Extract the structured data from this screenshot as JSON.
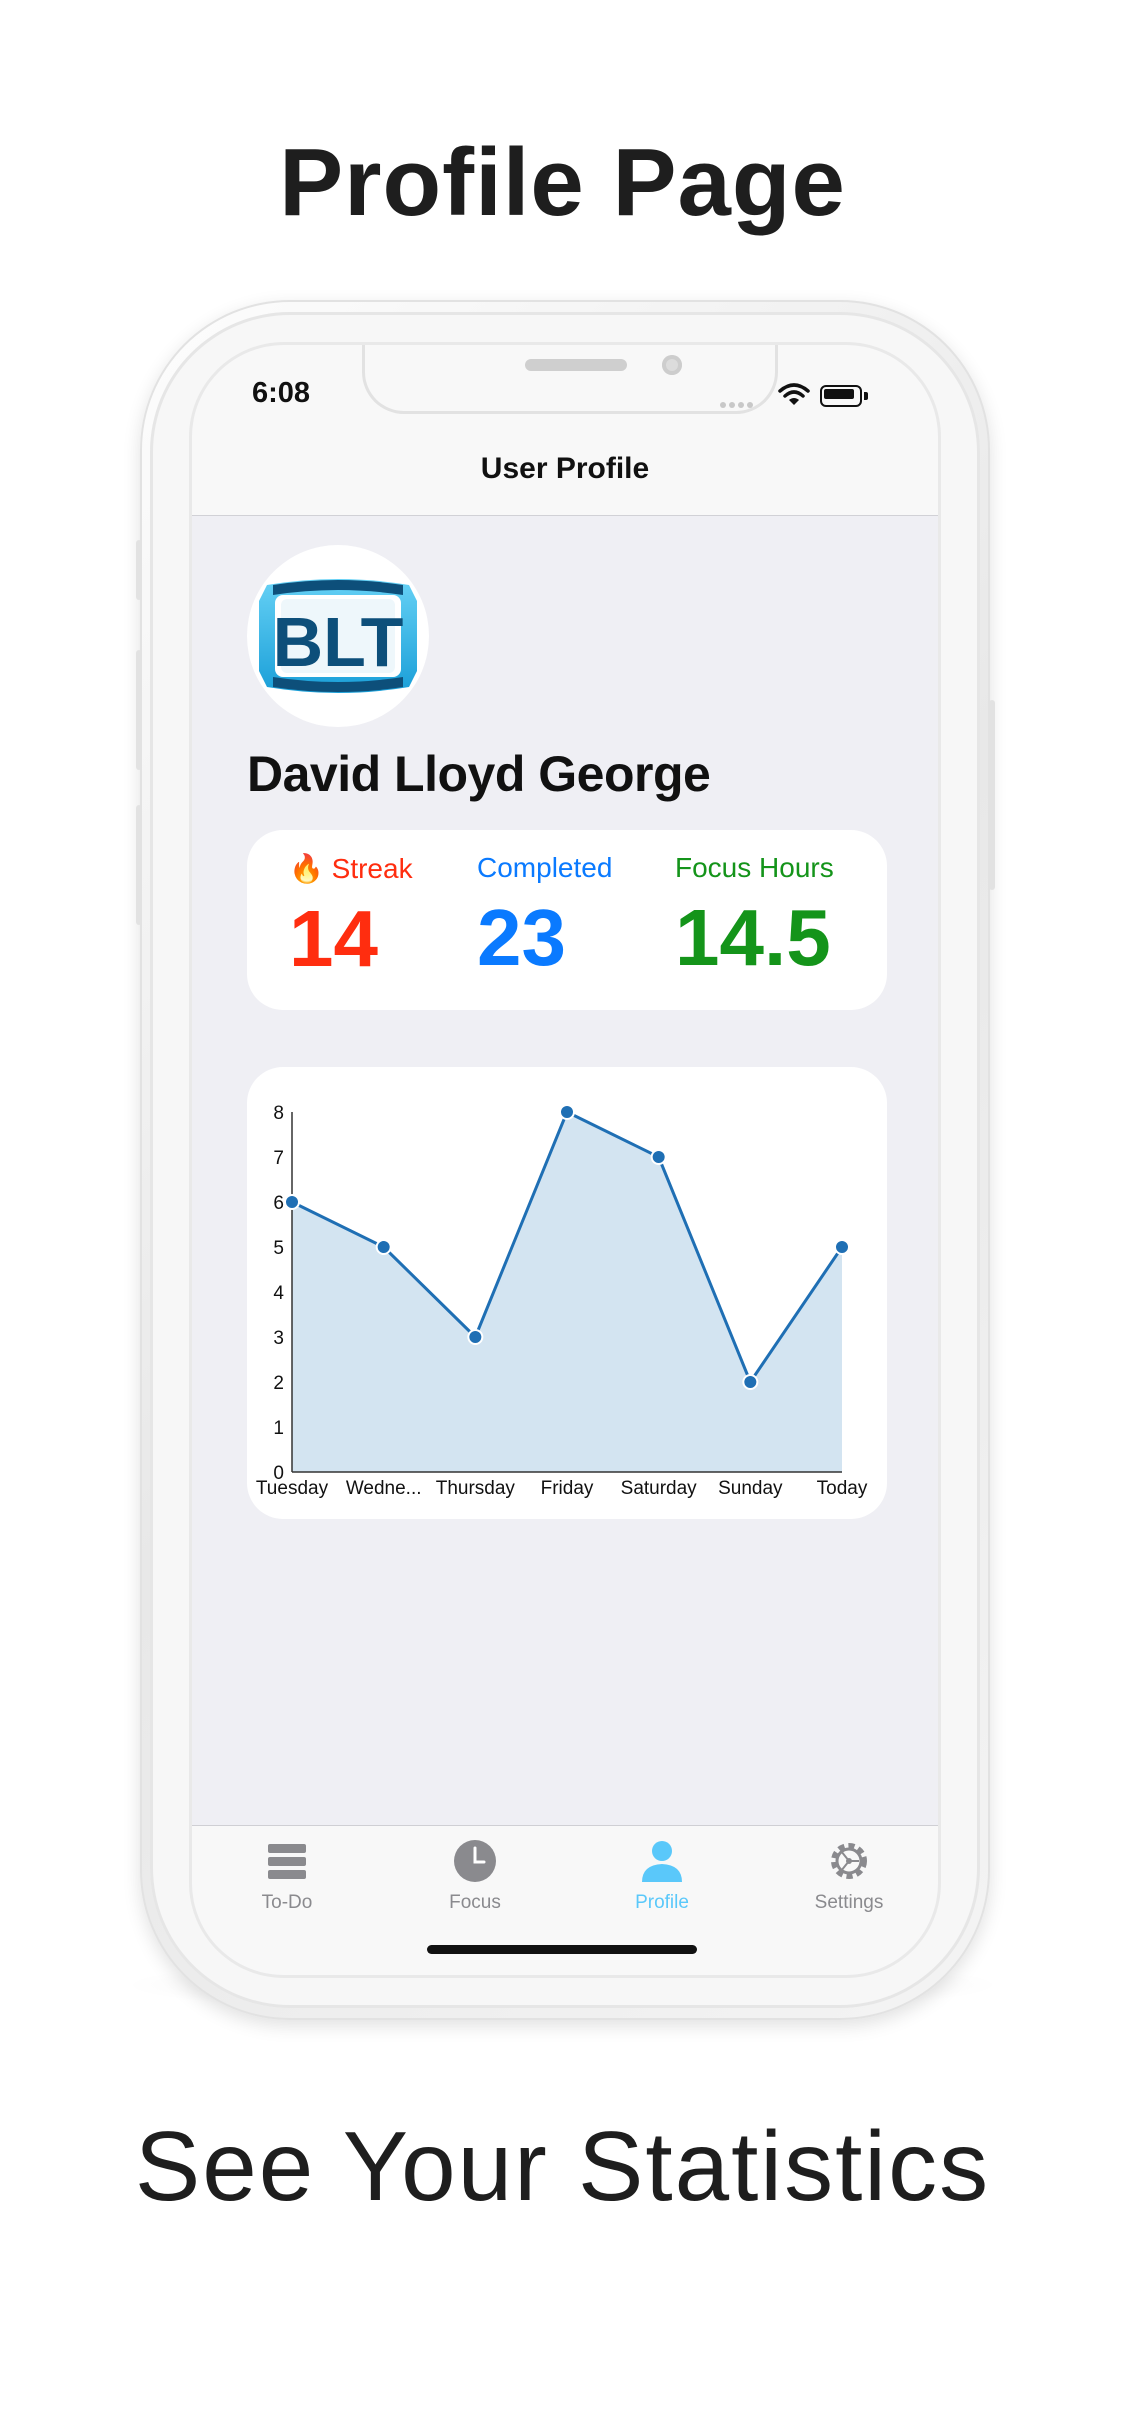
{
  "headline_top": "Profile Page",
  "headline_bottom": "See Your Statistics",
  "status_bar": {
    "time": "6:08"
  },
  "nav": {
    "title": "User Profile"
  },
  "profile": {
    "avatar_text": "BLT",
    "name": "David Lloyd George"
  },
  "stats": {
    "streak": {
      "icon": "fire-emoji",
      "emoji": "🔥",
      "label": "Streak",
      "value": "14",
      "color": "#ff2d0f"
    },
    "completed": {
      "label": "Completed",
      "value": "23",
      "color": "#0a7aff"
    },
    "focus_hours": {
      "label": "Focus Hours",
      "value": "14.5",
      "color": "#14941a"
    }
  },
  "chart_data": {
    "type": "area",
    "categories": [
      "Tuesday",
      "Wedne...",
      "Thursday",
      "Friday",
      "Saturday",
      "Sunday",
      "Today"
    ],
    "values": [
      6,
      5,
      3,
      8,
      7,
      2,
      5
    ],
    "ylim": [
      0,
      8
    ],
    "yticks": [
      "0",
      "1",
      "2",
      "3",
      "4",
      "5",
      "6",
      "7",
      "8"
    ],
    "grid": false,
    "line_color": "#1f6fb4",
    "fill_color": "#d3e4f1"
  },
  "tabs": [
    {
      "label": "To-Do",
      "icon": "list-icon",
      "active": false
    },
    {
      "label": "Focus",
      "icon": "clock-icon",
      "active": false
    },
    {
      "label": "Profile",
      "icon": "person-icon",
      "active": true
    },
    {
      "label": "Settings",
      "icon": "gear-icon",
      "active": false
    }
  ],
  "colors": {
    "accent_active_tab": "#5ac8fa",
    "inactive_tab": "#8a8a8e",
    "screen_background": "#efeff4"
  }
}
